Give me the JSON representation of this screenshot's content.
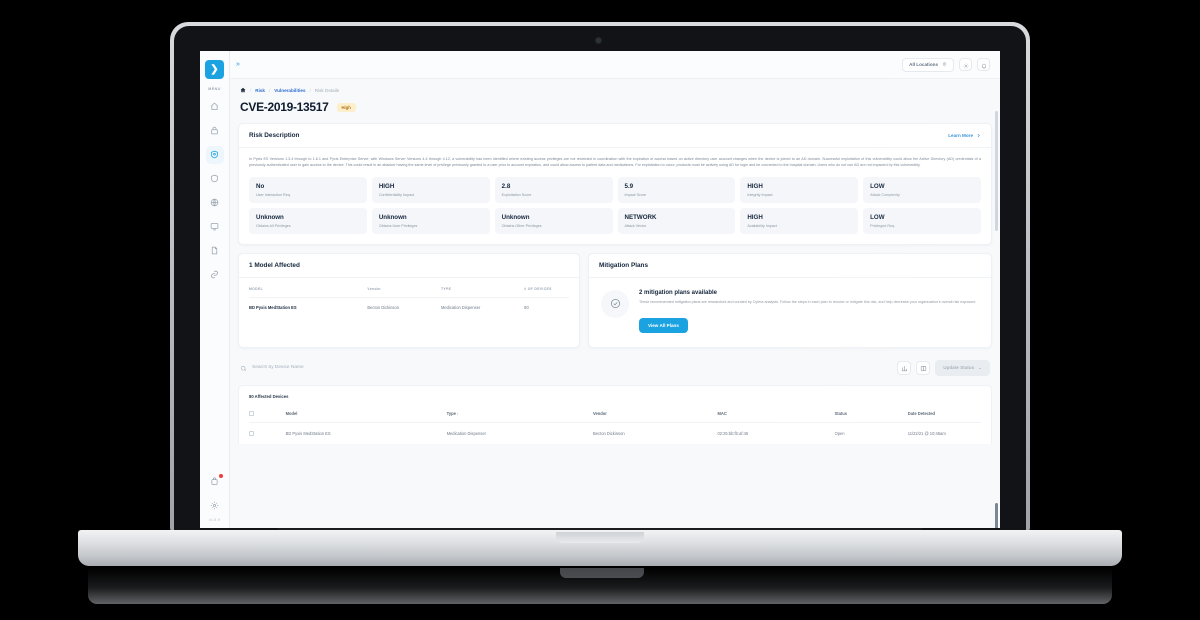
{
  "brand": {
    "logo_glyph": "❯",
    "accent": "#1ba2e0",
    "menu_label": "MENU",
    "version": "v1.8.9"
  },
  "sidebar": {
    "items": [
      {
        "name": "home",
        "label": "Home"
      },
      {
        "name": "inventory",
        "label": "Inventory"
      },
      {
        "name": "risk",
        "label": "Risk",
        "active": true
      },
      {
        "name": "security",
        "label": "Security"
      },
      {
        "name": "network",
        "label": "Network"
      },
      {
        "name": "monitor",
        "label": "Monitoring"
      },
      {
        "name": "reports",
        "label": "Reports"
      },
      {
        "name": "integrations",
        "label": "Integrations"
      }
    ],
    "bottom": [
      {
        "name": "notifications",
        "label": "Notifications",
        "has_badge": true
      },
      {
        "name": "settings",
        "label": "Settings"
      }
    ]
  },
  "topbar": {
    "collapse_glyph": "»",
    "location_label": "All Locations",
    "buttons": [
      {
        "name": "settings",
        "label": "Settings"
      },
      {
        "name": "notifications",
        "label": "Notifications"
      }
    ]
  },
  "breadcrumb": {
    "home": "Home",
    "items": [
      {
        "label": "Risk",
        "type": "link"
      },
      {
        "label": "Vulnerabilities",
        "type": "link"
      },
      {
        "label": "Risk Details",
        "type": "current"
      }
    ],
    "separator": "/"
  },
  "page": {
    "title": "CVE-2019-13517",
    "severity_badge": "High",
    "severity_color": "#b1751a"
  },
  "risk_description": {
    "title": "Risk Description",
    "learn_more": "Learn More",
    "body": "In Pyxis ES Versions 1.3.4 through to 1.6.1 and Pyxis Enterprise Server, with Windows Server Versions 4.4 through 4.12, a vulnerability has been identified where existing access privileges are not restricted in coordination with the expiration of access based on active directory user account changes when the device is joined to an AD domain. Successful exploitation of this vulnerability could allow the Active Directory (AD) credentials of a previously authenticated user to gain access to the device. This could result in an attacker having the same level of privilege previously granted to a user prior to account expiration, and could allow access to patient data and medications. For exploitation to occur, products must be actively using AD for login and be connected to the hospital domain. Users who do not use AD are not impacted by this vulnerability."
  },
  "metrics": [
    {
      "value": "No",
      "label": "User Interaction Req."
    },
    {
      "value": "HIGH",
      "label": "Confidentiality Impact"
    },
    {
      "value": "2.8",
      "label": "Exploitation Score"
    },
    {
      "value": "5.9",
      "label": "Impact Score"
    },
    {
      "value": "HIGH",
      "label": "Integrity Impact"
    },
    {
      "value": "LOW",
      "label": "Attack Complexity"
    },
    {
      "value": "Unknown",
      "label": "Obtains All Privileges"
    },
    {
      "value": "Unknown",
      "label": "Obtains User Privileges"
    },
    {
      "value": "Unknown",
      "label": "Obtains Other Privileges"
    },
    {
      "value": "NETWORK",
      "label": "Attack Vector"
    },
    {
      "value": "HIGH",
      "label": "Availability Impact"
    },
    {
      "value": "LOW",
      "label": "Privileged Req."
    }
  ],
  "models_affected": {
    "title": "1 Model Affected",
    "columns": [
      "MODEL",
      "Vendor",
      "TYPE",
      "# OF DEVICES"
    ],
    "rows": [
      {
        "model": "BD Pyxis MedStation ES",
        "vendor": "Becton Dickinson",
        "type": "Medication Dispenser",
        "devices": "80"
      }
    ]
  },
  "mitigation": {
    "title": "Mitigation Plans",
    "headline": "2 mitigation plans available",
    "body": "These recommended mitigation plans are researched and curated by Cylera analysts. Follow the steps in each plan to resolve or mitigate this risk, and help decrease your organization's overall risk exposure.",
    "button": "View All Plans"
  },
  "toolbar": {
    "search_placeholder": "Search by Device Name",
    "search_value": "",
    "icon_buttons": [
      {
        "name": "export",
        "label": "Export"
      },
      {
        "name": "columns",
        "label": "Columns"
      }
    ],
    "update_status_label": "Update Status",
    "update_status_caret": "⌄",
    "update_status_disabled": true
  },
  "devices_table": {
    "heading": "80 Affected Devices",
    "columns": [
      "Model",
      "Type",
      "Vendor",
      "MAC",
      "Status",
      "Date Detected"
    ],
    "sort_column": "Type",
    "sort_caret": "↑",
    "rows": [
      {
        "model": "BD Pyxis MedStation ES",
        "type": "Medication Dispenser",
        "vendor": "Becton Dickinson",
        "mac": "02:25:bb:fb:af:45",
        "status": "Open",
        "date": "11/22/21 @ 10:45am"
      }
    ]
  }
}
